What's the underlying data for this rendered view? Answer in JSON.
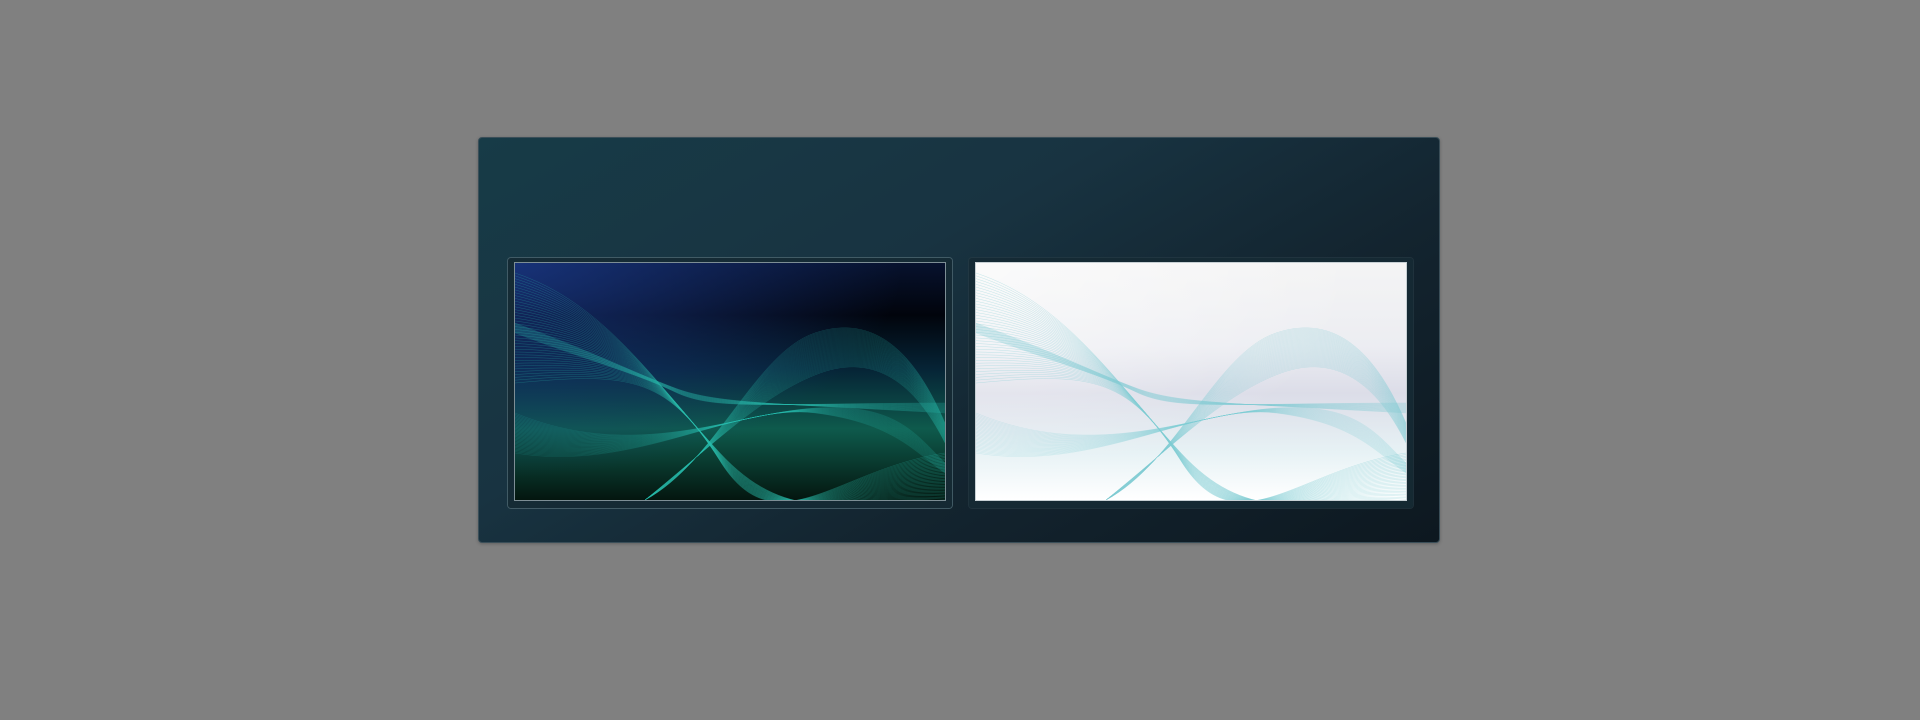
{
  "window": {
    "name": "wallpaper-picker"
  },
  "wallpapers": [
    {
      "name": "wave-dark",
      "theme": "dark",
      "selected": true,
      "colors": {
        "sky_top": "#0f1b4a",
        "sky_mid": "#010510",
        "glow": "#1f8a7a",
        "wave": "#2bbfb0",
        "bottom": "#04160f"
      }
    },
    {
      "name": "wave-light",
      "theme": "light",
      "selected": false,
      "colors": {
        "sky_top": "#f4f4f4",
        "sky_mid": "#dcdde8",
        "glow": "#c9ecf0",
        "wave": "#7fcbd3",
        "bottom": "#ffffff"
      }
    }
  ],
  "accent_color": "#2bbfb0"
}
